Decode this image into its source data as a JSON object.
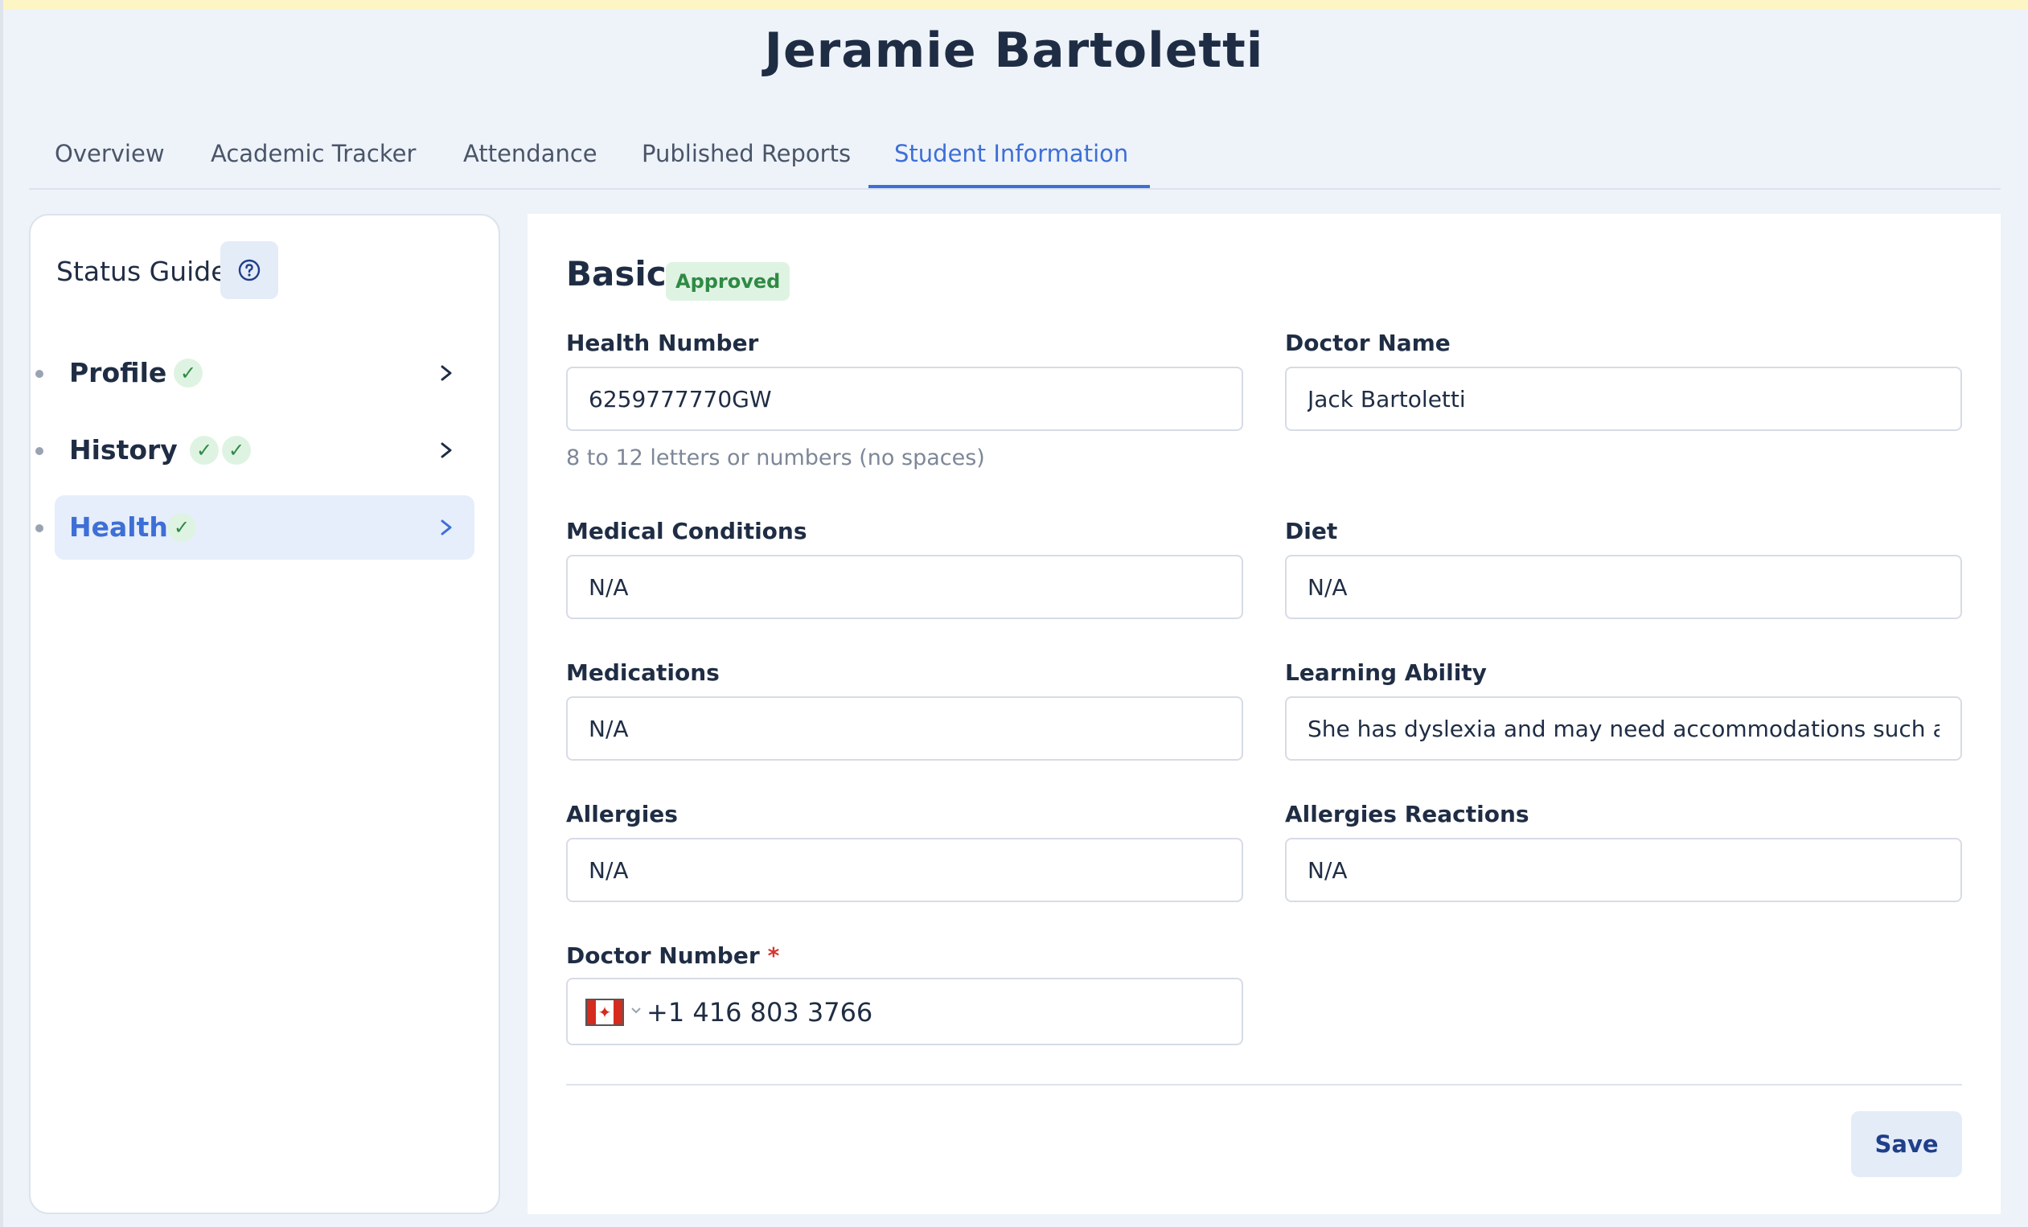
{
  "page": {
    "title": "Jeramie Bartoletti"
  },
  "tabs": [
    {
      "label": "Overview"
    },
    {
      "label": "Academic Tracker"
    },
    {
      "label": "Attendance"
    },
    {
      "label": "Published Reports"
    },
    {
      "label": "Student Information",
      "active": true
    }
  ],
  "sidebar": {
    "title": "Status Guide",
    "help_icon": "question-circle-icon",
    "items": [
      {
        "label": "Profile",
        "checks": 1
      },
      {
        "label": "History",
        "checks": 2
      },
      {
        "label": "Health",
        "checks": 1,
        "active": true
      }
    ]
  },
  "form": {
    "section_title": "Basic",
    "status_badge": "Approved",
    "health_number": {
      "label": "Health Number",
      "value": "6259777770GW",
      "hint": "8 to 12 letters or numbers (no spaces)"
    },
    "doctor_name": {
      "label": "Doctor Name",
      "value": "Jack Bartoletti"
    },
    "medical_conditions": {
      "label": "Medical Conditions",
      "value": "N/A"
    },
    "diet": {
      "label": "Diet",
      "value": "N/A"
    },
    "medications": {
      "label": "Medications",
      "value": "N/A"
    },
    "learning_ability": {
      "label": "Learning Ability",
      "value": "She has dyslexia and may need accommodations such as s"
    },
    "allergies": {
      "label": "Allergies",
      "value": "N/A"
    },
    "allergies_reactions": {
      "label": "Allergies Reactions",
      "value": "N/A"
    },
    "doctor_number": {
      "label": "Doctor Number",
      "required_mark": "*",
      "country": "CA",
      "value": "+1 416 803 3766"
    },
    "save_label": "Save"
  },
  "colors": {
    "accent": "#3d6fd6",
    "success": "#2f8a44",
    "success_bg": "#dff3e3",
    "required": "#d8362f",
    "page_bg": "#eef3fa"
  }
}
